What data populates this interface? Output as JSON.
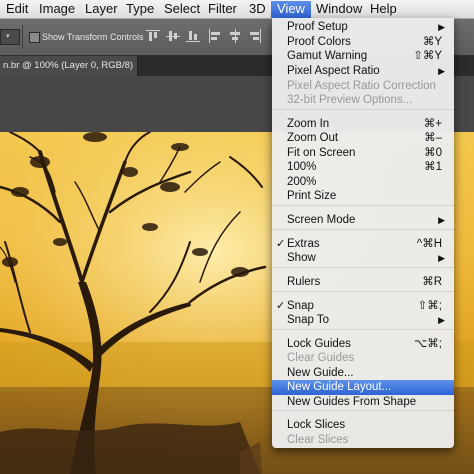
{
  "menubar": {
    "items": [
      "Edit",
      "Image",
      "Layer",
      "Type",
      "Select",
      "Filter",
      "3D",
      "View",
      "Window",
      "Help"
    ],
    "active": "View"
  },
  "options_bar": {
    "checkbox_label": "Show Transform Controls",
    "checkbox_checked": false
  },
  "document_tab": {
    "label": "n.br @ 100% (Layer 0, RGB/8) *"
  },
  "view_menu": {
    "items": [
      {
        "label": "Proof Setup",
        "shortcut": "",
        "submenu": true,
        "enabled": true,
        "checked": false
      },
      {
        "label": "Proof Colors",
        "shortcut": "⌘Y",
        "submenu": false,
        "enabled": true,
        "checked": false
      },
      {
        "label": "Gamut Warning",
        "shortcut": "⇧⌘Y",
        "submenu": false,
        "enabled": true,
        "checked": false
      },
      {
        "label": "Pixel Aspect Ratio",
        "shortcut": "",
        "submenu": true,
        "enabled": true,
        "checked": false
      },
      {
        "label": "Pixel Aspect Ratio Correction",
        "shortcut": "",
        "submenu": false,
        "enabled": false,
        "checked": false
      },
      {
        "label": "32-bit Preview Options...",
        "shortcut": "",
        "submenu": false,
        "enabled": false,
        "checked": false
      },
      {
        "label": "Zoom In",
        "shortcut": "⌘+",
        "submenu": false,
        "enabled": true,
        "checked": false
      },
      {
        "label": "Zoom Out",
        "shortcut": "⌘–",
        "submenu": false,
        "enabled": true,
        "checked": false
      },
      {
        "label": "Fit on Screen",
        "shortcut": "⌘0",
        "submenu": false,
        "enabled": true,
        "checked": false
      },
      {
        "label": "100%",
        "shortcut": "⌘1",
        "submenu": false,
        "enabled": true,
        "checked": false
      },
      {
        "label": "200%",
        "shortcut": "",
        "submenu": false,
        "enabled": true,
        "checked": false
      },
      {
        "label": "Print Size",
        "shortcut": "",
        "submenu": false,
        "enabled": true,
        "checked": false
      },
      {
        "label": "Screen Mode",
        "shortcut": "",
        "submenu": true,
        "enabled": true,
        "checked": false
      },
      {
        "label": "Extras",
        "shortcut": "^⌘H",
        "submenu": false,
        "enabled": true,
        "checked": true
      },
      {
        "label": "Show",
        "shortcut": "",
        "submenu": true,
        "enabled": true,
        "checked": false
      },
      {
        "label": "Rulers",
        "shortcut": "⌘R",
        "submenu": false,
        "enabled": true,
        "checked": false
      },
      {
        "label": "Snap",
        "shortcut": "⇧⌘;",
        "submenu": false,
        "enabled": true,
        "checked": true
      },
      {
        "label": "Snap To",
        "shortcut": "",
        "submenu": true,
        "enabled": true,
        "checked": false
      },
      {
        "label": "Lock Guides",
        "shortcut": "⌥⌘;",
        "submenu": false,
        "enabled": true,
        "checked": false
      },
      {
        "label": "Clear Guides",
        "shortcut": "",
        "submenu": false,
        "enabled": false,
        "checked": false
      },
      {
        "label": "New Guide...",
        "shortcut": "",
        "submenu": false,
        "enabled": true,
        "checked": false
      },
      {
        "label": "New Guide Layout...",
        "shortcut": "",
        "submenu": false,
        "enabled": true,
        "checked": false,
        "highlighted": true
      },
      {
        "label": "New Guides From Shape",
        "shortcut": "",
        "submenu": false,
        "enabled": true,
        "checked": false
      },
      {
        "label": "Lock Slices",
        "shortcut": "",
        "submenu": false,
        "enabled": true,
        "checked": false
      },
      {
        "label": "Clear Slices",
        "shortcut": "",
        "submenu": false,
        "enabled": false,
        "checked": false
      }
    ]
  },
  "colors": {
    "menu_highlight": "#2d63d5",
    "disabled_text": "#9a9a9a",
    "photo_sky": "#f3c84e"
  }
}
